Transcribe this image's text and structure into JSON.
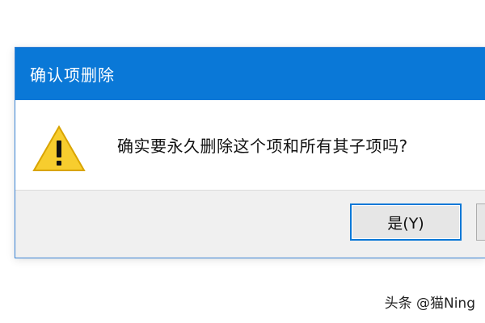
{
  "dialog": {
    "title": "确认项删除",
    "message": "确实要永久删除这个项和所有其子项吗?",
    "icon": "warning-icon",
    "yes_label": "是(Y)",
    "no_label": ""
  },
  "colors": {
    "titlebar": "#0a78d7",
    "title_text": "#ffffff",
    "footer": "#f0f0f0",
    "button_focus_border": "#0a78d7",
    "warning_fill": "#f7cd2e"
  },
  "watermark": {
    "text": "头条 @猫Ning"
  }
}
